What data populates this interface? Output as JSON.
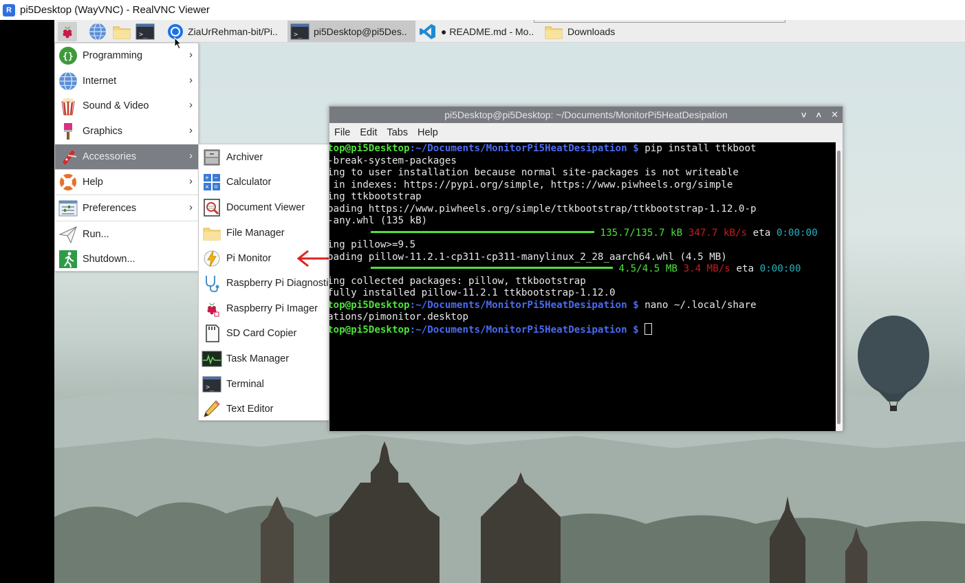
{
  "viewer": {
    "title": "pi5Desktop (WayVNC) - RealVNC Viewer",
    "logo_text": "R"
  },
  "taskbar": {
    "launchers": [
      "raspberry-pi-icon",
      "globe-icon",
      "folder-icon",
      "terminal-icon"
    ],
    "tasks": [
      {
        "label": "ZiaUrRehman-bit/Pi..",
        "icon": "chromium-icon",
        "active": false
      },
      {
        "label": "pi5Desktop@pi5Des..",
        "icon": "terminal-icon",
        "active": true
      },
      {
        "label": "● README.md - Mo..",
        "icon": "vscode-icon",
        "active": false
      },
      {
        "label": "Downloads",
        "icon": "folder-icon",
        "active": false
      }
    ]
  },
  "main_menu": {
    "items": [
      {
        "label": "Programming",
        "icon": "programming-icon",
        "submenu": true
      },
      {
        "label": "Internet",
        "icon": "globe-icon",
        "submenu": true
      },
      {
        "label": "Sound & Video",
        "icon": "popcorn-icon",
        "submenu": true
      },
      {
        "label": "Graphics",
        "icon": "paintbrush-icon",
        "submenu": true
      },
      {
        "label": "Accessories",
        "icon": "pocketknife-icon",
        "submenu": true,
        "highlighted": true
      },
      {
        "label": "Help",
        "icon": "lifebuoy-icon",
        "submenu": true
      },
      {
        "label": "Preferences",
        "icon": "preferences-icon",
        "submenu": true
      },
      {
        "label": "Run...",
        "icon": "paper-plane-icon",
        "submenu": false
      },
      {
        "label": "Shutdown...",
        "icon": "exit-icon",
        "submenu": false
      }
    ]
  },
  "accessories_menu": {
    "items": [
      {
        "label": "Archiver",
        "icon": "archive-icon"
      },
      {
        "label": "Calculator",
        "icon": "calculator-icon"
      },
      {
        "label": "Document Viewer",
        "icon": "document-viewer-icon"
      },
      {
        "label": "File Manager",
        "icon": "folder-icon"
      },
      {
        "label": "Pi Monitor",
        "icon": "lightning-icon"
      },
      {
        "label": "Raspberry Pi Diagnostics",
        "icon": "stethoscope-icon"
      },
      {
        "label": "Raspberry Pi Imager",
        "icon": "raspberry-pi-icon"
      },
      {
        "label": "SD Card Copier",
        "icon": "sd-card-icon"
      },
      {
        "label": "Task Manager",
        "icon": "task-manager-icon"
      },
      {
        "label": "Terminal",
        "icon": "terminal-icon"
      },
      {
        "label": "Text Editor",
        "icon": "pencil-icon"
      }
    ]
  },
  "terminal": {
    "title": "pi5Desktop@pi5Desktop: ~/Documents/MonitorPi5HeatDesipation",
    "controls": [
      "˅",
      "˄",
      "✕"
    ],
    "menu": [
      "File",
      "Edit",
      "Tabs",
      "Help"
    ],
    "prompt_user": "top@pi5Desktop",
    "prompt_path": ":~/Documents/MonitorPi5HeatDesipation $",
    "line1_cmd": " pip install ttkboot",
    "line2": "-break-system-packages",
    "line3": "ing to user installation because normal site-packages is not writeable",
    "line4": " in indexes: https://pypi.org/simple, https://www.piwheels.org/simple",
    "line5": "ing ttkbootstrap",
    "line6": "oading https://www.piwheels.org/simple/ttkbootstrap/ttkbootstrap-1.12.0-p",
    "line7": "-any.whl (135 kB)",
    "p1_size": "135.7/135.7 kB",
    "p1_speed": "347.7 kB/s",
    "p1_eta_label": "eta",
    "p1_eta": "0:00:00",
    "line9": "ing pillow>=9.5",
    "line10": "oading pillow-11.2.1-cp311-cp311-manylinux_2_28_aarch64.whl (4.5 MB)",
    "p2_size": "4.5/4.5 MB",
    "p2_speed": "3.4 MB/s",
    "p2_eta_label": "eta",
    "p2_eta": "0:00:00",
    "line12": "ing collected packages: pillow, ttkbootstrap",
    "line13": "fully installed pillow-11.2.1 ttkbootstrap-1.12.0",
    "line14_cmd": " nano ~/.local/share",
    "line15": "ations/pimonitor.desktop"
  },
  "colors": {
    "terminal_green": "#4ee23a",
    "terminal_blue": "#4a6bf0",
    "terminal_red": "#c81c1c",
    "terminal_cyan": "#22b5c0",
    "menu_highlight": "#7b7f85",
    "annotation_red": "#e02020"
  }
}
